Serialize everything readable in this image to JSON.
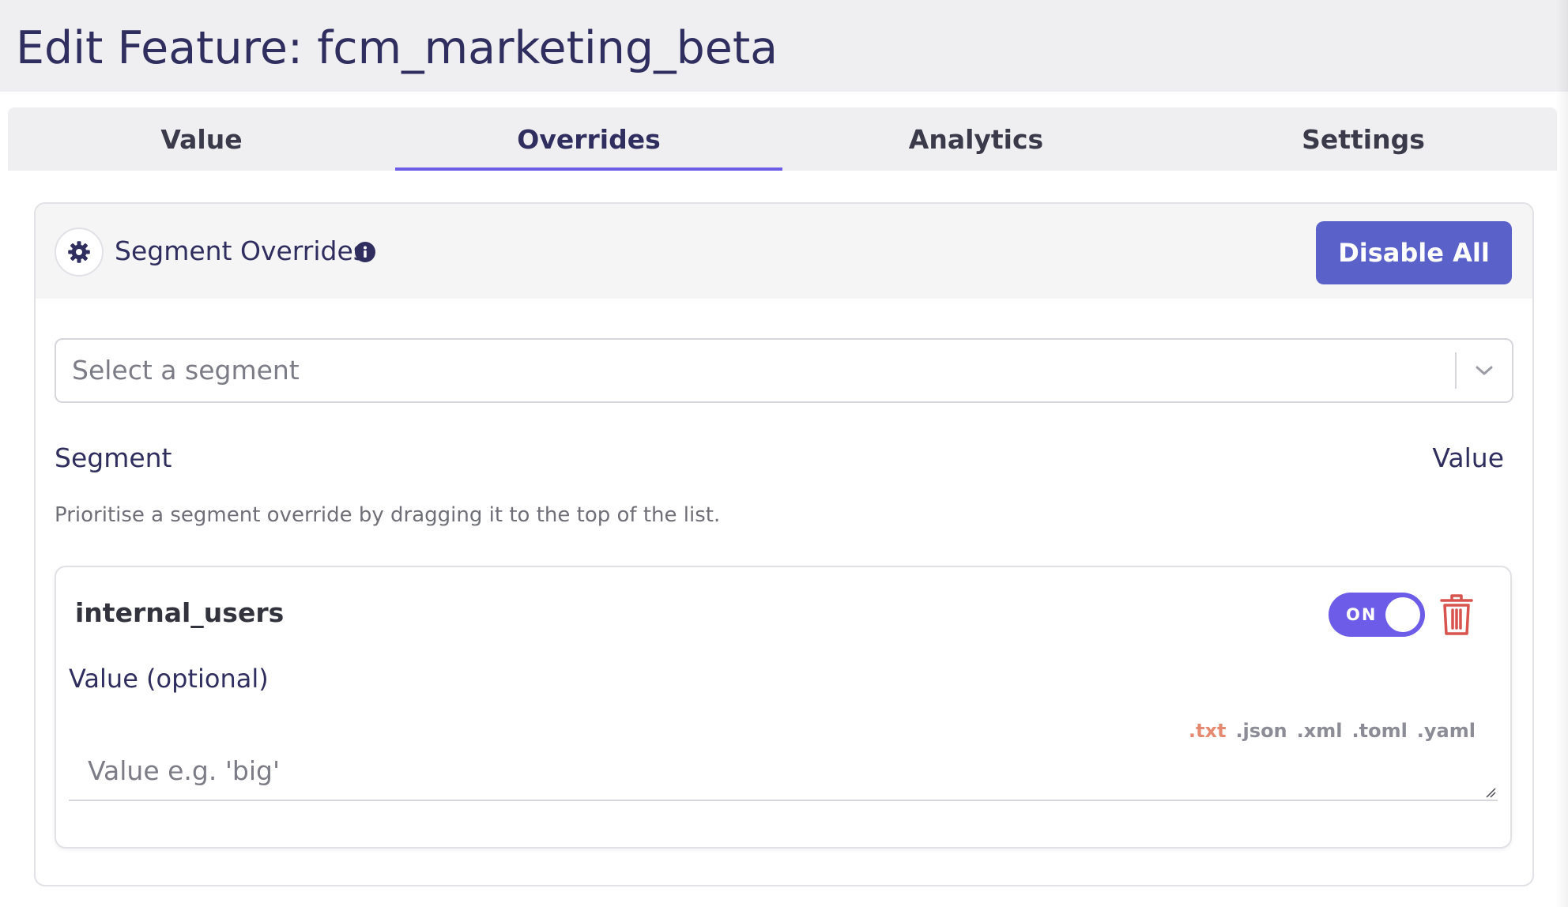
{
  "modal": {
    "title": "Edit Feature: fcm_marketing_beta"
  },
  "tabs": [
    {
      "label": "Value",
      "active": false
    },
    {
      "label": "Overrides",
      "active": true
    },
    {
      "label": "Analytics",
      "active": false
    },
    {
      "label": "Settings",
      "active": false
    }
  ],
  "segment_overrides": {
    "title": "Segment Overrides",
    "icon": "gear-icon",
    "info_icon": "info-icon",
    "disable_all_label": "Disable All",
    "select": {
      "placeholder": "Select a segment"
    },
    "columns": {
      "segment": "Segment",
      "value": "Value"
    },
    "hint": "Prioritise a segment override by dragging it to the top of the list.",
    "overrides": [
      {
        "segment": "internal_users",
        "enabled": true,
        "toggle_label": "ON",
        "value_label": "Value (optional)",
        "value": "",
        "value_placeholder": "Value e.g. 'big'",
        "languages": [
          ".txt",
          ".json",
          ".xml",
          ".toml",
          ".yaml"
        ],
        "selected_language": ".txt"
      }
    ]
  },
  "colors": {
    "title": "#2f2e5f",
    "accent": "#6c5ce7",
    "button": "#5a61c9",
    "delete": "#d9534f",
    "active_language": "#e58a70"
  }
}
